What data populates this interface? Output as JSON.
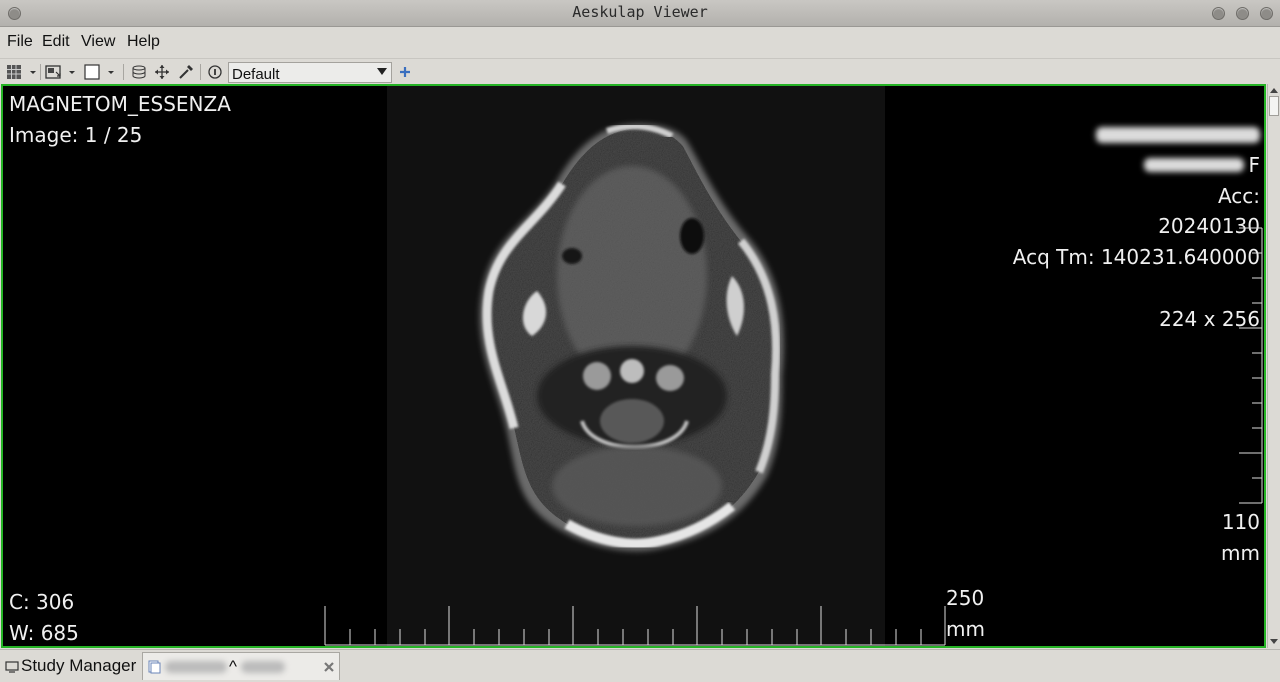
{
  "window": {
    "title": "Aeskulap Viewer"
  },
  "menu": [
    "File",
    "Edit",
    "View",
    "Help"
  ],
  "toolbar": {
    "icons": [
      "grid-icon",
      "dropdown-arrow-icon",
      "layout-icon",
      "dropdown-arrow-icon",
      "frame-icon",
      "dropdown-arrow-icon",
      "stack-icon",
      "move-icon",
      "pipette-icon",
      "info-icon"
    ],
    "preset_value": "Default",
    "add_icon": "+"
  },
  "overlay": {
    "top_left": {
      "modality": "MAGNETOM_ESSENZA",
      "image": "Image: 1 / 25"
    },
    "top_right": {
      "patient_sex": "F",
      "acc": "Acc:",
      "date": "20240130",
      "acq_time": "Acq Tm: 140231.640000",
      "matrix": "224 x 256"
    },
    "bottom_left": {
      "center": "C: 306",
      "width": "W: 685"
    },
    "ruler_h": {
      "value": "250",
      "unit": "mm"
    },
    "ruler_v": {
      "value": "110",
      "unit": "mm"
    }
  },
  "tabs": [
    {
      "label": "Study Manager"
    },
    {
      "label": "^"
    }
  ],
  "colors": {
    "viewer_border": "#25b325",
    "background": "#dcdad5"
  }
}
